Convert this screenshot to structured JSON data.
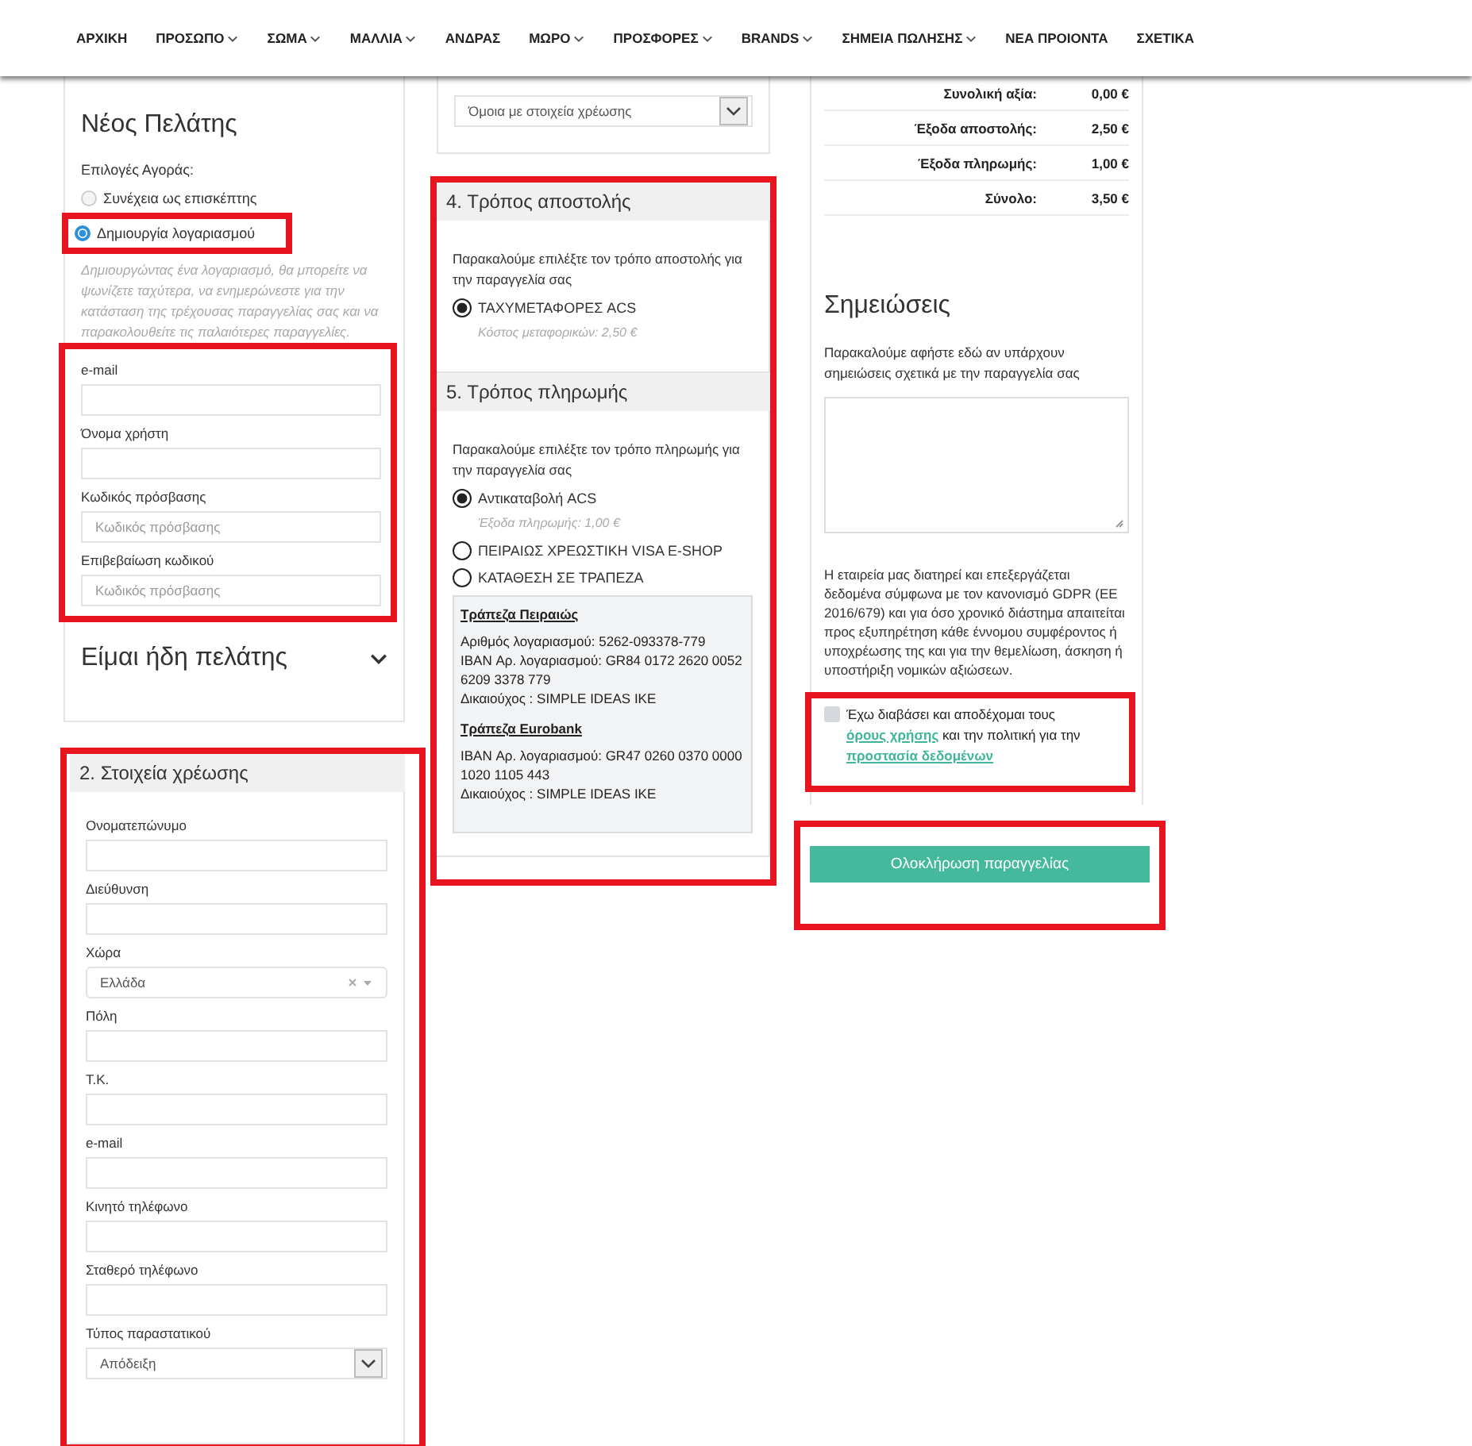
{
  "nav": [
    {
      "label": "ΑΡΧΙΚΗ",
      "dropdown": false
    },
    {
      "label": "ΠΡΟΣΩΠΟ",
      "dropdown": true
    },
    {
      "label": "ΣΩΜΑ",
      "dropdown": true
    },
    {
      "label": "ΜΑΛΛΙΑ",
      "dropdown": true
    },
    {
      "label": "ΑΝΔΡΑΣ",
      "dropdown": false
    },
    {
      "label": "ΜΩΡΟ",
      "dropdown": true
    },
    {
      "label": "ΠΡΟΣΦΟΡΕΣ",
      "dropdown": true
    },
    {
      "label": "BRANDS",
      "dropdown": true
    },
    {
      "label": "ΣΗΜΕΙΑ ΠΩΛΗΣΗΣ",
      "dropdown": true
    },
    {
      "label": "ΝΕΑ ΠΡΟΙΟΝΤΑ",
      "dropdown": false
    },
    {
      "label": "ΣΧΕΤΙΚΑ",
      "dropdown": false
    }
  ],
  "new_customer": {
    "title": "Νέος Πελάτης",
    "options_label": "Επιλογές Αγοράς:",
    "options": [
      {
        "label": "Συνέχεια ως επισκέπτης",
        "selected": false,
        "highlighted": false
      },
      {
        "label": "Δημιουργία λογαριασμού",
        "selected": true,
        "highlighted": true
      }
    ],
    "description": "Δημιουργώντας ένα λογαριασμό, θα μπορείτε να ψωνίζετε ταχύτερα, να ενημερώνεστε για την κατάσταση της τρέχουσας παραγγελίας σας και να παρακολουθείτε τις παλαιότερες παραγγελίες.",
    "fields_highlighted": true,
    "fields": [
      {
        "label": "e-mail"
      },
      {
        "label": "Όνομα χρήστη"
      },
      {
        "label": "Κωδικός πρόσβασης",
        "placeholder": "Κωδικός πρόσβασης"
      },
      {
        "label": "Επιβεβαίωση κωδικού",
        "placeholder": "Κωδικός πρόσβασης"
      }
    ]
  },
  "existing_customer": {
    "title": "Είμαι ήδη πελάτης",
    "expanded": false
  },
  "billing": {
    "title": "2. Στοιχεία χρέωσης",
    "highlighted": true,
    "fields": [
      {
        "label": "Ονοματεπώνυμο",
        "kind": "text"
      },
      {
        "label": "Διεύθυνση",
        "kind": "text"
      },
      {
        "label": "Χώρα",
        "kind": "combo",
        "value": "Ελλάδα"
      },
      {
        "label": "Πόλη",
        "kind": "text"
      },
      {
        "label": "Τ.Κ.",
        "kind": "text"
      },
      {
        "label": "e-mail",
        "kind": "text"
      },
      {
        "label": "Κινητό τηλέφωνο",
        "kind": "text"
      },
      {
        "label": "Σταθερό τηλέφωνο",
        "kind": "text"
      },
      {
        "label": "Τύπος παραστατικού",
        "kind": "select",
        "value": "Απόδειξη"
      }
    ]
  },
  "shipping_address": {
    "value": "Όμοια με στοιχεία χρέωσης"
  },
  "shipping_payment_highlighted": true,
  "shipping": {
    "title": "4. Τρόπος αποστολής",
    "prompt": "Παρακαλούμε επιλέξτε τον τρόπο αποστολής για την παραγγελία σας",
    "options": [
      {
        "label": "ΤΑΧΥΜΕΤΑΦΟΡΕΣ ACS",
        "selected": true,
        "note": "Κόστος μεταφορικών: 2,50 €"
      }
    ]
  },
  "payment": {
    "title": "5. Τρόπος πληρωμής",
    "prompt": "Παρακαλούμε επιλέξτε τον τρόπο πληρωμής για την παραγγελία σας",
    "options": [
      {
        "label": "Αντικαταβολή ACS",
        "selected": true,
        "note": "Έξοδα πληρωμής: 1,00 €"
      },
      {
        "label": "ΠΕΙΡΑΙΩΣ ΧΡΕΩΣΤΙΚΗ VISA E-SHOP",
        "selected": false
      },
      {
        "label": "ΚΑΤΑΘΕΣΗ ΣΕ ΤΡΑΠΕΖΑ",
        "selected": false
      }
    ],
    "banks": [
      {
        "name": "Τράπεζα Πειραιώς",
        "lines": [
          "Αριθμός λογαριασμού: 5262-093378-779",
          "IBAN Αρ. λογαριασμού: GR84 0172 2620 0052 6209 3378 779",
          "Δικαιούχος : SIMPLE IDEAS IKE"
        ]
      },
      {
        "name": "Τράπεζα Eurobank",
        "lines": [
          "IBAN Αρ. λογαριασμού: GR47 0260 0370 0000 1020 1105 443",
          "Δικαιούχος : SIMPLE IDEAS IKE"
        ]
      }
    ]
  },
  "totals": [
    {
      "label": "Συνολική αξία:",
      "value": "0,00 €"
    },
    {
      "label": "Έξοδα αποστολής:",
      "value": "2,50 €"
    },
    {
      "label": "Έξοδα πληρωμής:",
      "value": "1,00 €"
    },
    {
      "label": "Σύνολο:",
      "value": "3,50 €"
    }
  ],
  "notes": {
    "title": "Σημειώσεις",
    "prompt": "Παρακαλούμε αφήστε εδώ αν υπάρχουν σημειώσεις σχετικά με την παραγγελία σας"
  },
  "gdpr_text": "Η εταιρεία μας διατηρεί και επεξεργάζεται δεδομένα σύμφωνα με τον κανονισμό GDPR (ΕΕ 2016/679) και για όσο χρονικό διάστημα απαιτείται προς εξυπηρέτηση κάθε έννομου συμφέροντος ή υποχρέωσης της και για την θεμελίωση, άσκηση ή υποστήριξη νομικών αξιώσεων.",
  "terms": {
    "checked": false,
    "highlighted": true,
    "text_1": "Έχω διαβάσει και αποδέχομαι τους",
    "link_1": "όρους χρήσης",
    "text_2": "και την πολιτική για την",
    "link_2": "προστασία δεδομένων"
  },
  "submit": {
    "label": "Ολοκλήρωση παραγγελίας",
    "highlighted": true
  }
}
